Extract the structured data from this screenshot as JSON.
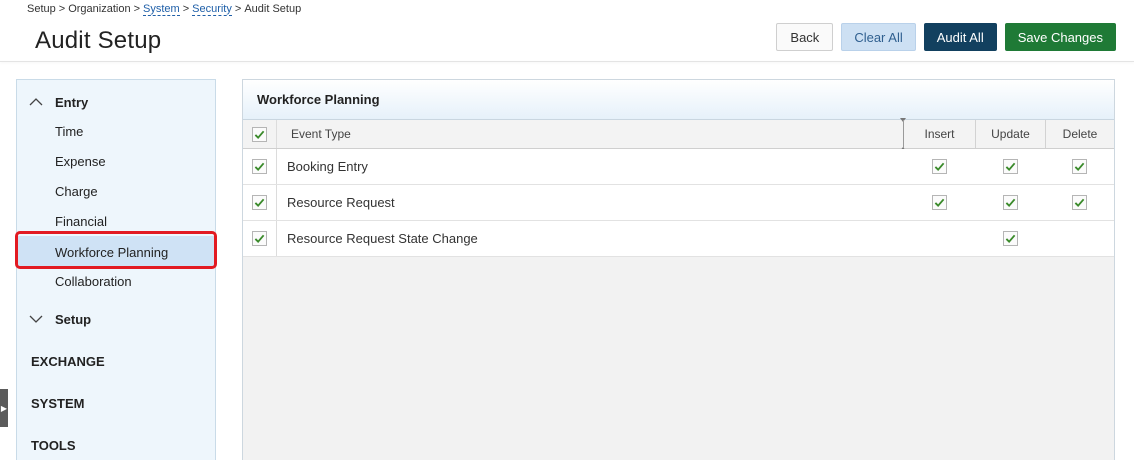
{
  "breadcrumb": {
    "items": [
      "Setup",
      "Organization",
      "System",
      "Security",
      "Audit Setup"
    ],
    "separator": ">"
  },
  "page": {
    "title": "Audit Setup"
  },
  "toolbar": {
    "back_label": "Back",
    "clear_all_label": "Clear All",
    "audit_all_label": "Audit All",
    "save_label": "Save Changes"
  },
  "sidebar": {
    "groups": [
      {
        "label": "Entry",
        "expanded": true,
        "items": [
          "Time",
          "Expense",
          "Charge",
          "Financial",
          "Workforce Planning",
          "Collaboration"
        ],
        "selected": "Workforce Planning"
      },
      {
        "label": "Setup",
        "expanded": false
      }
    ],
    "sections": [
      "EXCHANGE",
      "SYSTEM",
      "TOOLS"
    ]
  },
  "panel": {
    "title": "Workforce Planning",
    "columns": {
      "event_type": "Event Type",
      "insert": "Insert",
      "update": "Update",
      "delete": "Delete"
    },
    "header_checked": true,
    "rows": [
      {
        "event_type": "Booking Entry",
        "selected": true,
        "insert": true,
        "update": true,
        "delete": true
      },
      {
        "event_type": "Resource Request",
        "selected": true,
        "insert": true,
        "update": true,
        "delete": true
      },
      {
        "event_type": "Resource Request State Change",
        "selected": true,
        "insert": false,
        "update": true,
        "delete": false
      }
    ]
  },
  "colors": {
    "accent_blue": "#12405f",
    "save_green": "#1f7a36",
    "clear_blue": "#cde0f3",
    "check_green": "#3a8a2a",
    "highlight_red": "#e21a22"
  }
}
